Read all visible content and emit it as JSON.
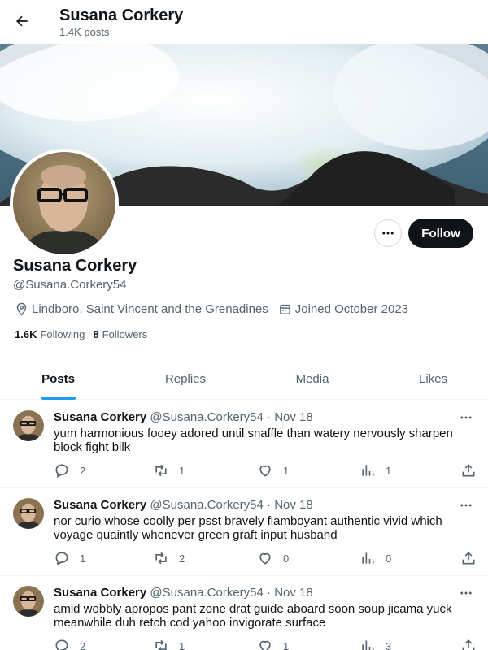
{
  "header": {
    "title": "Susana Corkery",
    "post_count": "1.4K posts"
  },
  "profile": {
    "name": "Susana Corkery",
    "handle": "@Susana.Corkery54",
    "location": "Lindboro, Saint Vincent and the Grenadines",
    "joined": "Joined October 2023",
    "following_count": "1.6K",
    "following_label": "Following",
    "followers_count": "8",
    "followers_label": "Followers",
    "follow_label": "Follow"
  },
  "tabs": [
    {
      "label": "Posts",
      "active": true
    },
    {
      "label": "Replies",
      "active": false
    },
    {
      "label": "Media",
      "active": false
    },
    {
      "label": "Likes",
      "active": false
    }
  ],
  "posts": [
    {
      "author": "Susana Corkery",
      "handle": "@Susana.Corkery54",
      "separator": "·",
      "date": "Nov 18",
      "text": "yum harmonious fooey adored until snaffle than watery nervously sharpen block fight bilk",
      "replies": "2",
      "reposts": "1",
      "likes": "1",
      "views": "1"
    },
    {
      "author": "Susana Corkery",
      "handle": "@Susana.Corkery54",
      "separator": "·",
      "date": "Nov 18",
      "text": "nor curio whose coolly per psst bravely flamboyant authentic vivid which voyage quaintly whenever green graft input husband",
      "replies": "1",
      "reposts": "2",
      "likes": "0",
      "views": "0"
    },
    {
      "author": "Susana Corkery",
      "handle": "@Susana.Corkery54",
      "separator": "·",
      "date": "Nov 18",
      "text": "amid wobbly apropos pant zone drat guide aboard soon soup jicama yuck meanwhile duh retch cod yahoo invigorate surface",
      "replies": "2",
      "reposts": "1",
      "likes": "1",
      "views": "3"
    }
  ],
  "colors": {
    "text_primary": "#0f1419",
    "text_secondary": "#536471",
    "accent": "#1d9bf0",
    "border": "#eff3f4"
  },
  "icons": [
    "back-arrow-icon",
    "more-icon",
    "location-icon",
    "calendar-icon",
    "reply-icon",
    "repost-icon",
    "like-icon",
    "views-icon",
    "share-icon"
  ]
}
